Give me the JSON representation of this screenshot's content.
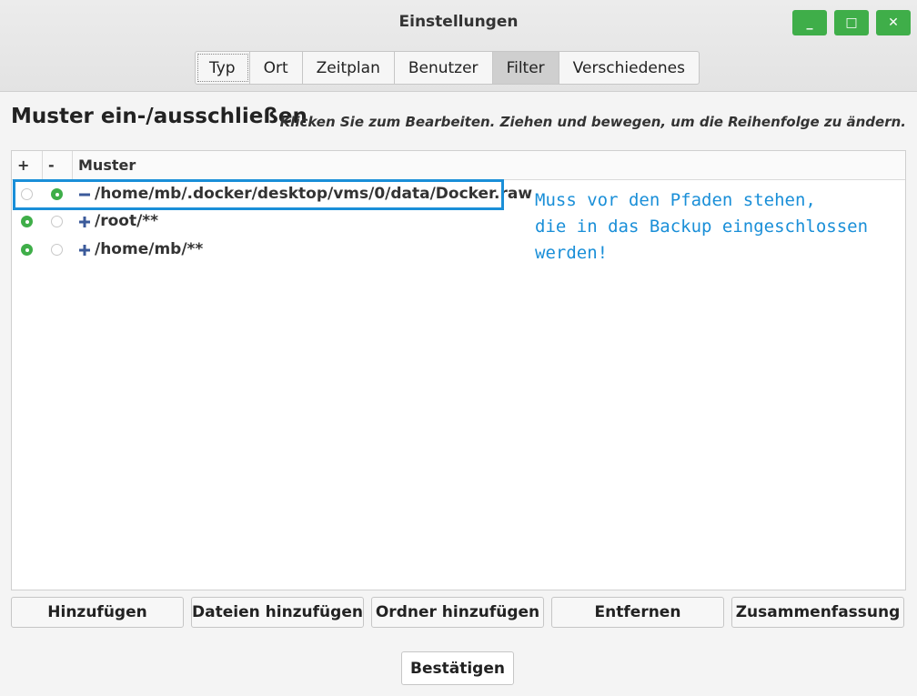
{
  "window": {
    "title": "Einstellungen",
    "controls": {
      "minimize": "_",
      "maximize": "□",
      "close": "✕"
    },
    "accent": "#3fae49"
  },
  "tabs": [
    {
      "label": "Typ"
    },
    {
      "label": "Ort"
    },
    {
      "label": "Zeitplan"
    },
    {
      "label": "Benutzer"
    },
    {
      "label": "Filter",
      "active": true
    },
    {
      "label": "Verschiedenes"
    }
  ],
  "section": {
    "heading": "Muster ein-/ausschließen",
    "hint": "Klicken Sie zum Bearbeiten. Ziehen und bewegen, um die Reihenfolge zu ändern."
  },
  "list": {
    "columns": {
      "include": "+",
      "exclude": "-",
      "pattern": "Muster"
    },
    "rows": [
      {
        "pattern": "/home/mb/.docker/desktop/vms/0/data/Docker.raw",
        "mode": "exclude",
        "icon": "minus-icon"
      },
      {
        "pattern": "/root/**",
        "mode": "include",
        "icon": "plus-icon"
      },
      {
        "pattern": "/home/mb/**",
        "mode": "include",
        "icon": "plus-icon"
      }
    ]
  },
  "annotation": {
    "text": "Muss vor den Pfaden stehen,\ndie in das Backup eingeschlossen\nwerden!",
    "color": "#1a8fd8"
  },
  "buttons": {
    "add": "Hinzufügen",
    "add_files": "Dateien hinzufügen",
    "add_folder": "Ordner hinzufügen",
    "remove": "Entfernen",
    "summary": "Zusammenfassung",
    "confirm": "Bestätigen"
  }
}
